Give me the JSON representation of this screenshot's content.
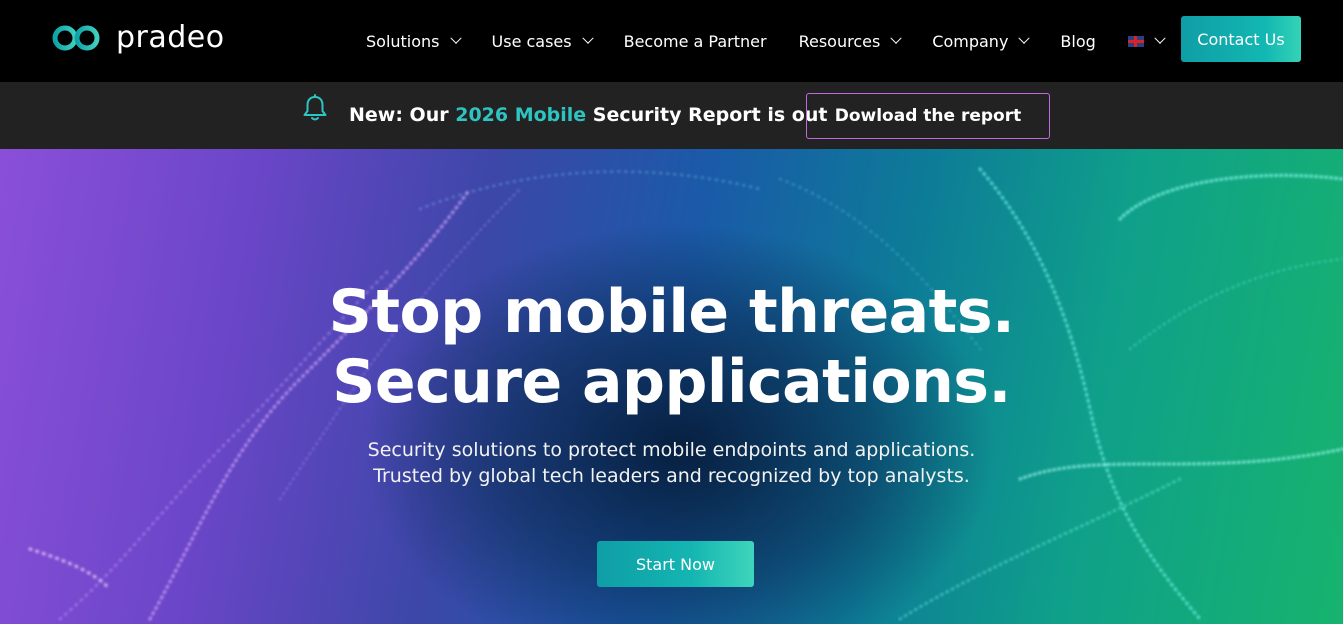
{
  "brand": {
    "name": "pradeo",
    "accent": "#12b7b2"
  },
  "nav": {
    "items": [
      {
        "label": "Solutions",
        "dropdown": true
      },
      {
        "label": "Use cases",
        "dropdown": true
      },
      {
        "label": "Become a Partner",
        "dropdown": false
      },
      {
        "label": "Resources",
        "dropdown": true
      },
      {
        "label": "Company",
        "dropdown": true
      },
      {
        "label": "Blog",
        "dropdown": false
      }
    ],
    "language_icon": "uk-flag-icon",
    "contact_label": "Contact Us"
  },
  "announcement": {
    "icon": "bell-icon",
    "text_before": "New: Our ",
    "highlight": "2026 Mobile",
    "text_after": " Security Report is out",
    "highlight_color": "#2ec4c1",
    "button_label": "Dowload the report"
  },
  "hero": {
    "title_line1": "Stop mobile threats.",
    "title_line2": "Secure applications.",
    "subtitle_line1": "Security solutions to protect mobile endpoints and applications.",
    "subtitle_line2": "Trusted by global tech leaders and recognized by top analysts.",
    "cta_label": "Start Now"
  }
}
